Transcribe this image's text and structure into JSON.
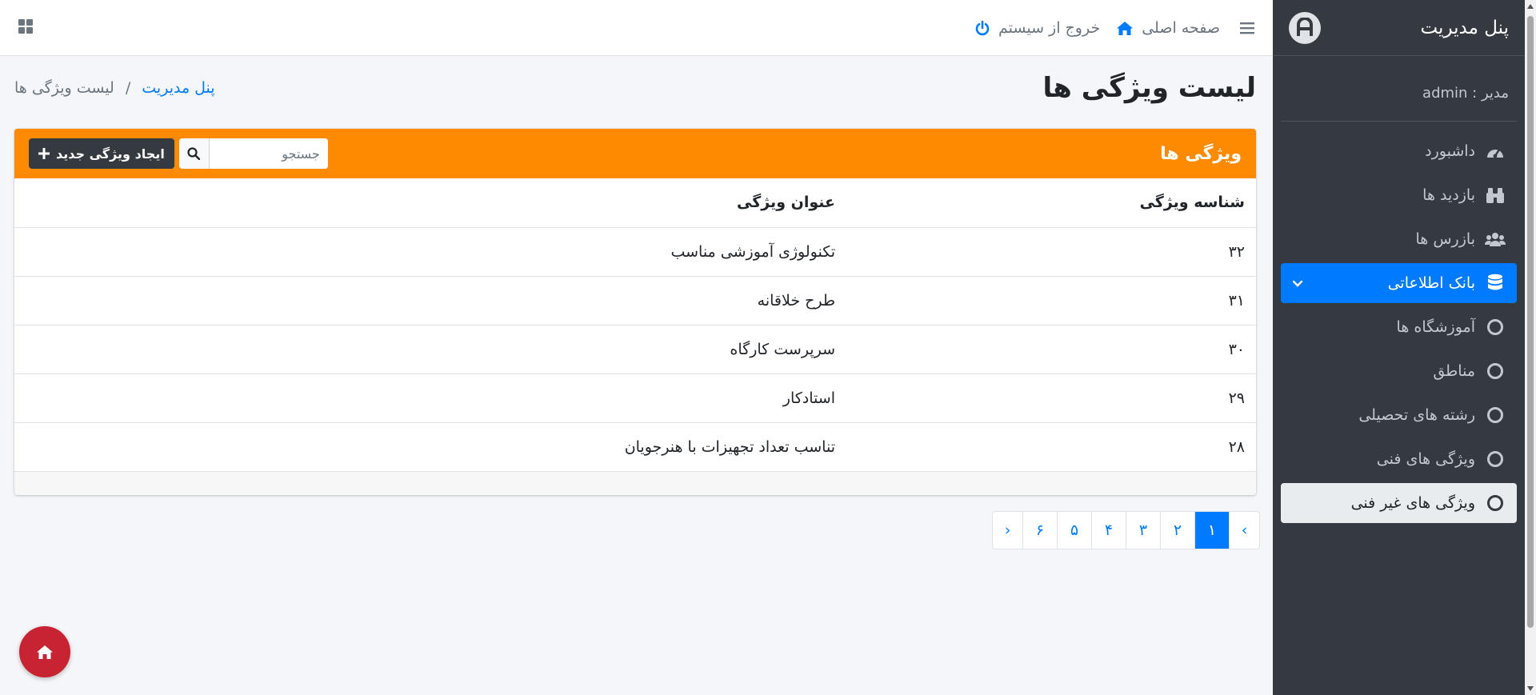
{
  "colors": {
    "sidebar_bg": "#343a40",
    "accent": "#007bff",
    "card_header": "#fd8a00",
    "fab": "#c82333"
  },
  "sidebar": {
    "brand": "پنل مدیریت",
    "user": "مدیر : admin",
    "items": [
      {
        "label": "داشبورد",
        "icon": "tachometer-icon"
      },
      {
        "label": "بازدید ها",
        "icon": "binoculars-icon"
      },
      {
        "label": "بازرس ها",
        "icon": "users-icon"
      },
      {
        "label": "بانک اطلاعاتی",
        "icon": "database-icon",
        "active": true
      },
      {
        "label": "آموزشگاه ها",
        "icon": "circle-icon"
      },
      {
        "label": "مناطق",
        "icon": "circle-icon"
      },
      {
        "label": "رشته های تحصیلی",
        "icon": "circle-icon"
      },
      {
        "label": "ویژگی های فنی",
        "icon": "circle-icon"
      },
      {
        "label": "ویژگی های غیر فنی",
        "icon": "circle-icon",
        "selected": true
      }
    ]
  },
  "navbar": {
    "home": "صفحه اصلی",
    "logout": "خروج از سیستم"
  },
  "header": {
    "title": "لیست ویژگی ها",
    "breadcrumb_root": "پنل مدیریت",
    "breadcrumb_sep": "/",
    "breadcrumb_current": "لیست ویژگی ها"
  },
  "card": {
    "title": "ویژگی ها",
    "search_placeholder": "جستجو",
    "new_button": "ایجاد ویژگی جدید",
    "columns": [
      "شناسه ویژگی",
      "عنوان ویژگی"
    ],
    "rows": [
      {
        "id": "۳۲",
        "title": "تکنولوژی آموزشی مناسب"
      },
      {
        "id": "۳۱",
        "title": "طرح خلاقانه"
      },
      {
        "id": "۳۰",
        "title": "سرپرست کارگاه"
      },
      {
        "id": "۲۹",
        "title": "استادکار"
      },
      {
        "id": "۲۸",
        "title": "تناسب تعداد تجهیزات با هنرجویان"
      }
    ]
  },
  "pagination": {
    "prev": "‹",
    "next": "›",
    "pages": [
      "۱",
      "۲",
      "۳",
      "۴",
      "۵",
      "۶"
    ],
    "current": "۱"
  }
}
